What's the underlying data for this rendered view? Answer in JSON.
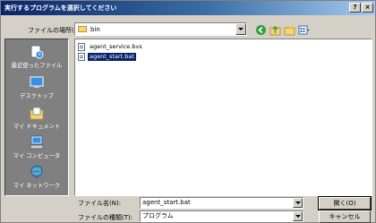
{
  "title": "実行するプログラムを選択してください",
  "title_buttons": {
    "help": "?",
    "close": "×"
  },
  "lookin": {
    "label": "ファイルの場所(I):",
    "value": "bin"
  },
  "places": [
    {
      "label": "最近使ったファイル",
      "icon": "recent-files-icon"
    },
    {
      "label": "デスクトップ",
      "icon": "desktop-icon"
    },
    {
      "label": "マイ ドキュメント",
      "icon": "my-documents-icon"
    },
    {
      "label": "マイ コンピュータ",
      "icon": "my-computer-icon"
    },
    {
      "label": "マイ ネットワーク",
      "icon": "my-network-icon"
    }
  ],
  "files": [
    {
      "name": "agent_service.bvs",
      "selected": false
    },
    {
      "name": "agent_start.bat",
      "selected": true
    }
  ],
  "filename": {
    "label": "ファイル名(N):",
    "value": "agent_start.bat"
  },
  "filetype": {
    "label": "ファイルの種類(T):",
    "value": "プログラム"
  },
  "buttons": {
    "open": "開く(O)",
    "cancel": "キャンセル"
  }
}
